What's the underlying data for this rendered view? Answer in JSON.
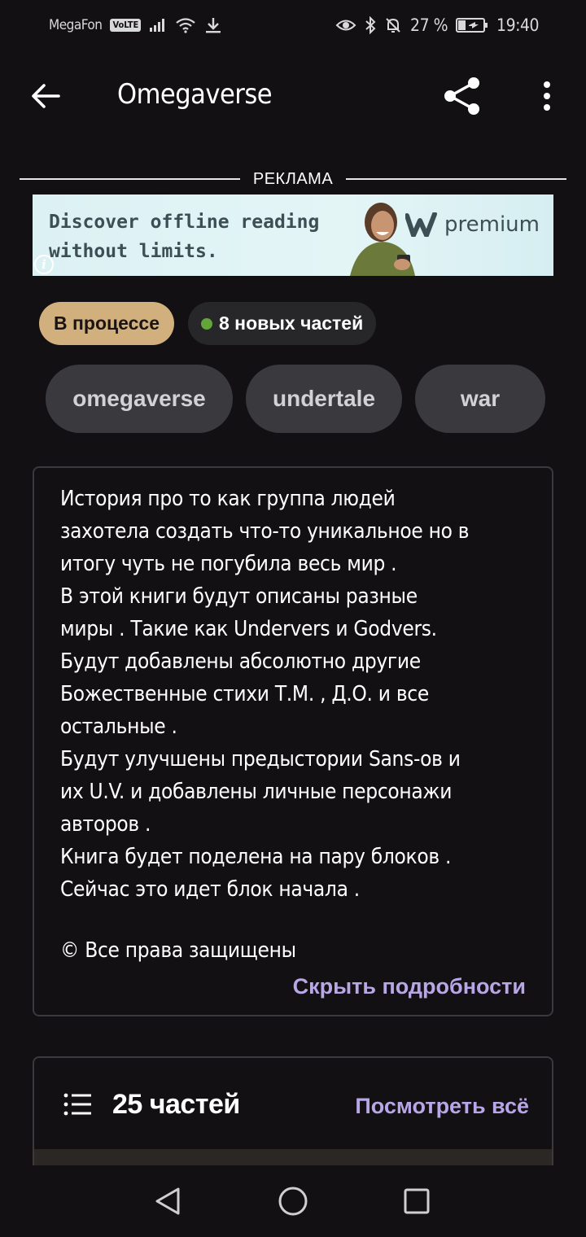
{
  "status_bar": {
    "carrier": "MegaFon",
    "volte": "VoLTE",
    "battery": "27 %",
    "time": "19:40"
  },
  "app_bar": {
    "title": "Omegaverse"
  },
  "ad": {
    "label": "РЕКЛАМА",
    "line1": "Discover offline reading",
    "line2": "without limits.",
    "brand": "premium"
  },
  "chips": {
    "status": "В процессе",
    "new_parts": "8 новых частей"
  },
  "tags": [
    "omegaverse",
    "undertale",
    "war"
  ],
  "description": {
    "text": "История про то как группа людей\nзахотела создать что-то уникальное но в\nитогу чуть не погубила весь мир .\nВ этой книги будут описаны разные\nмиры . Такие как Undervers и Godvers.\nБудут добавлены абсолютно другие\nБожественные стихи Т.М. , Д.О. и все\nостальные .\nБудут улучшены предыстории Sans-ов и\nих U.V. и добавлены личные персонажи\nавторов .\nКнига будет поделена на пару блоков .\nСейчас это идет блок начала .",
    "copyright": "© Все права защищены",
    "hide_label": "Скрыть подробности"
  },
  "parts": {
    "count_label": "25 частей",
    "view_all": "Посмотреть всё"
  },
  "colors": {
    "background": "#121013",
    "status_chip": "#d2b07d",
    "accent_link": "#b8a6e6",
    "new_dot": "#64a53a",
    "tag_bg": "#3a3a3e"
  }
}
